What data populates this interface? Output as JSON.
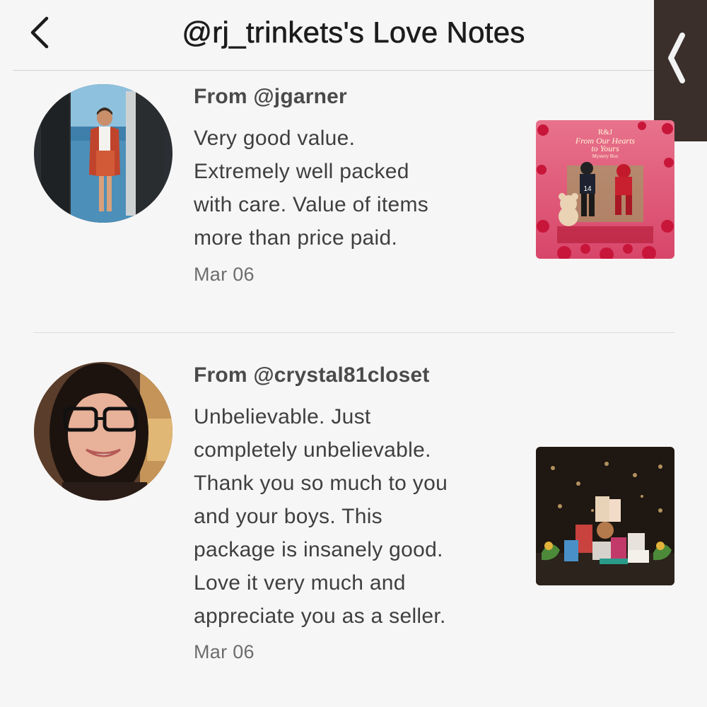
{
  "header": {
    "title": "@rj_trinkets's Love Notes",
    "back_icon": "chevron-left-icon",
    "side_tab_icon": "chevron-left-icon"
  },
  "notes": [
    {
      "from": "From @jgarner",
      "lines": [
        "Very good value.",
        "Extremely well packed",
        "with care. Value of items",
        "more than price paid."
      ],
      "date": "Mar 06",
      "thumb": {
        "brand": "R&J",
        "title": "From Our Hearts",
        "title2": "to Yours",
        "subtitle": "Mystery Box",
        "jersey": "14"
      }
    },
    {
      "from": "From @crystal81closet",
      "lines": [
        "Unbelievable. Just",
        "completely unbelievable.",
        "Thank you so much to you",
        "and your boys. This",
        "package is insanely good.",
        "Love it very much and",
        "appreciate you as a seller."
      ],
      "date": "Mar 06"
    }
  ],
  "colors": {
    "background": "#f7f6f6",
    "side_tab": "#3a2f2a",
    "card_pink": "#e05a78"
  }
}
